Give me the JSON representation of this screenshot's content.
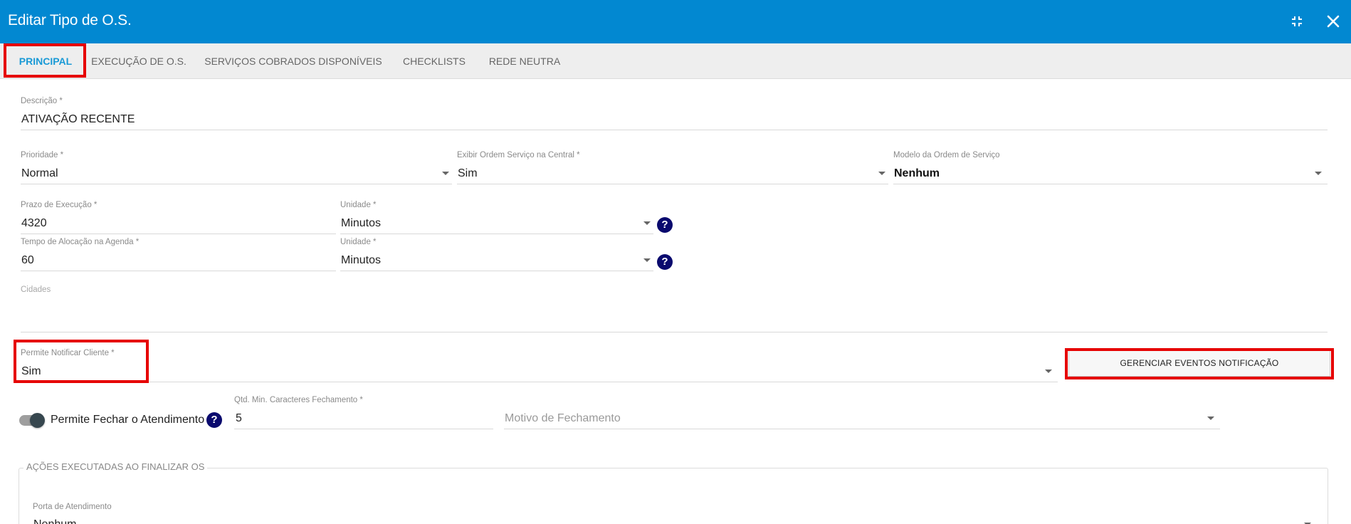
{
  "header": {
    "title": "Editar Tipo de O.S.",
    "collapse_icon": "collapse-icon",
    "close_icon": "close-icon"
  },
  "tabs": [
    {
      "label": "PRINCIPAL",
      "active": true
    },
    {
      "label": "EXECUÇÃO DE O.S.",
      "active": false
    },
    {
      "label": "SERVIÇOS COBRADOS DISPONÍVEIS",
      "active": false
    },
    {
      "label": "CHECKLISTS",
      "active": false
    },
    {
      "label": "REDE NEUTRA",
      "active": false
    }
  ],
  "form": {
    "descricao": {
      "label": "Descrição *",
      "value": "ATIVAÇÃO RECENTE"
    },
    "prioridade": {
      "label": "Prioridade *",
      "value": "Normal"
    },
    "exibir_central": {
      "label": "Exibir Ordem Serviço na Central *",
      "value": "Sim"
    },
    "modelo_os": {
      "label": "Modelo da Ordem de Serviço",
      "value": "Nenhum"
    },
    "prazo_execucao": {
      "label": "Prazo de Execução *",
      "value": "4320"
    },
    "unidade_prazo": {
      "label": "Unidade *",
      "value": "Minutos"
    },
    "tempo_alocacao": {
      "label": "Tempo de Alocação na Agenda *",
      "value": "60"
    },
    "unidade_alocacao": {
      "label": "Unidade *",
      "value": "Minutos"
    },
    "cidades": {
      "label": "Cidades",
      "value": ""
    },
    "permite_notificar": {
      "label": "Permite Notificar Cliente *",
      "value": "Sim"
    },
    "gerenciar_button": "GERENCIAR EVENTOS NOTIFICAÇÃO",
    "permite_fechar": {
      "label": "Permite Fechar o Atendimento",
      "checked": true
    },
    "qtd_min_caracteres": {
      "label": "Qtd. Min. Caracteres Fechamento *",
      "value": "5"
    },
    "motivo_fechamento": {
      "placeholder": "Motivo de Fechamento"
    },
    "acoes_legend": "AÇÕES EXECUTADAS AO FINALIZAR OS",
    "porta_atendimento": {
      "label": "Porta de Atendimento",
      "value": "Nenhum"
    }
  },
  "help_icon": "?",
  "colors": {
    "header_bg": "#0288d1",
    "tab_active": "#1a9ad6",
    "highlight": "#e60000",
    "help_icon_bg": "#0a0a6e"
  }
}
